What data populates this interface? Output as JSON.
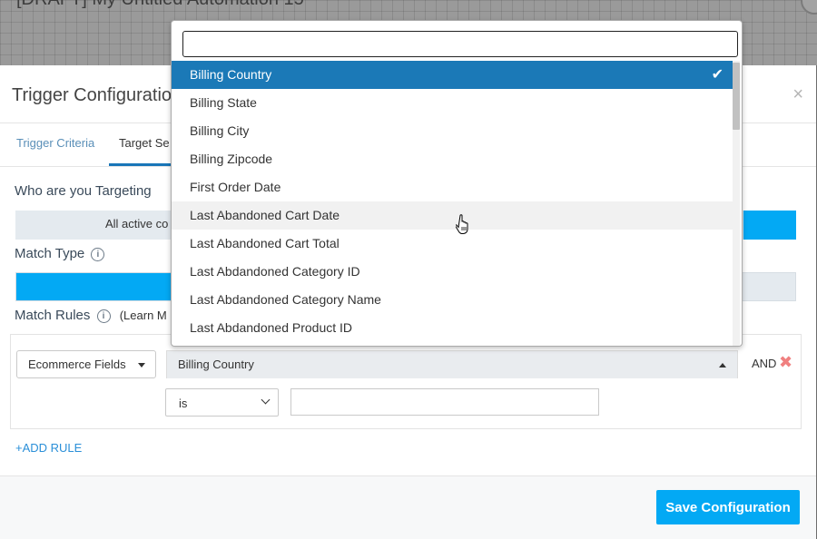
{
  "background": {
    "title": "[DRAFT] My Untitled Automation 15"
  },
  "modal": {
    "title": "Trigger Configuration",
    "close": "×",
    "tabs": [
      {
        "label": "Trigger Criteria"
      },
      {
        "label": "Target Se"
      }
    ],
    "who_label": "Who are you Targeting",
    "target_text": "All active co",
    "match_type_label": "Match Type",
    "match_rules_label": "Match Rules",
    "learn_more": "(Learn M",
    "info_glyph": "i"
  },
  "rule": {
    "category": "Ecommerce Fields",
    "field": "Billing Country",
    "and_label": "AND",
    "remove_glyph": "✖",
    "operator": "is",
    "value": ""
  },
  "add_rule": "+ADD RULE",
  "footer": {
    "save_label": "Save Configuration"
  },
  "dropdown": {
    "search_value": "",
    "check_glyph": "✔",
    "items": [
      {
        "label": "Billing Country"
      },
      {
        "label": "Billing State"
      },
      {
        "label": "Billing City"
      },
      {
        "label": "Billing Zipcode"
      },
      {
        "label": "First Order Date"
      },
      {
        "label": "Last Abandoned Cart Date"
      },
      {
        "label": "Last Abandoned Cart Total"
      },
      {
        "label": "Last Abdandoned Category ID"
      },
      {
        "label": "Last Abdandoned Category Name"
      },
      {
        "label": "Last Abdandoned Product ID"
      }
    ],
    "selected_index": 0,
    "hover_index": 5
  },
  "colors": {
    "accent": "#03a9f4",
    "selected_row": "#1b79b7",
    "link": "#2a8fd8",
    "remove": "#f08080"
  }
}
